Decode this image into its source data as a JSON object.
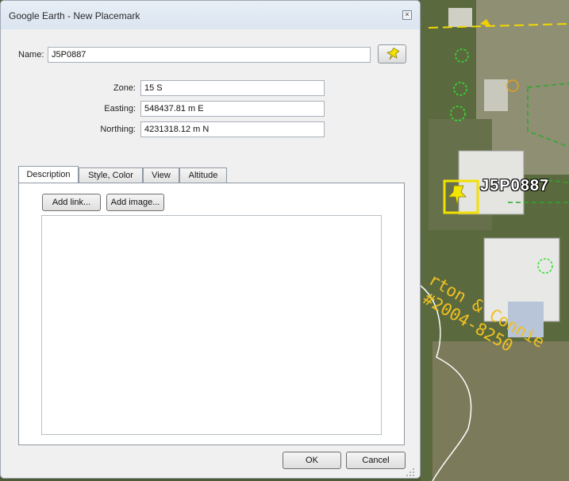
{
  "dialog": {
    "title": "Google Earth - New Placemark",
    "close_glyph": "×",
    "name_label": "Name:",
    "name_value": "J5P0887",
    "pin_icon": "pushpin-icon",
    "zone_label": "Zone:",
    "zone_value": "15 S",
    "easting_label": "Easting:",
    "easting_value": "548437.81 m E",
    "northing_label": "Northing:",
    "northing_value": "4231318.12 m N",
    "tabs": [
      {
        "label": "Description",
        "active": true
      },
      {
        "label": "Style, Color",
        "active": false
      },
      {
        "label": "View",
        "active": false
      },
      {
        "label": "Altitude",
        "active": false
      }
    ],
    "add_link_label": "Add link...",
    "add_image_label": "Add image...",
    "description_value": "",
    "ok_label": "OK",
    "cancel_label": "Cancel"
  },
  "map": {
    "placemark_label": "J5P0887",
    "parcel_text_1": "rton & Connie",
    "parcel_text_2": "#2004-8250",
    "accent_yellow": "#f2e200",
    "annotation_orange": "#f0c020"
  }
}
